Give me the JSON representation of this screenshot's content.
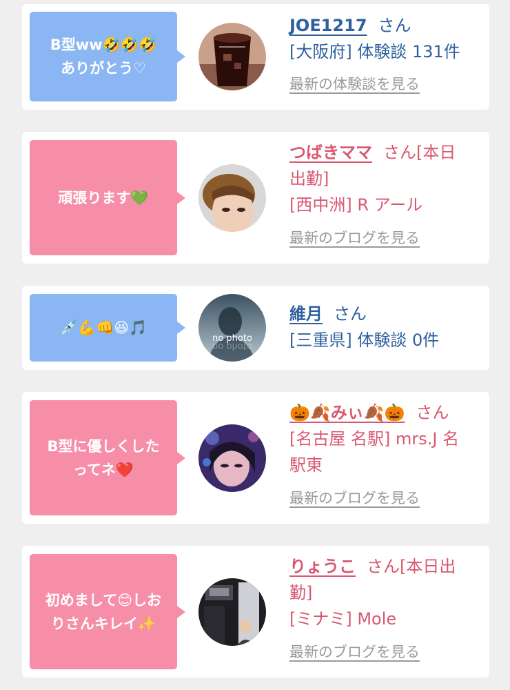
{
  "entries": [
    {
      "bubble": [
        "B型ww🤣🤣🤣",
        "ありがとう♡"
      ],
      "name": "JOE1217",
      "suffix": "さん",
      "lines": [
        "[大阪府] 体験談 131件"
      ],
      "link": "最新の体験談を見る"
    },
    {
      "bubble": [
        "頑張ります💚"
      ],
      "name": "つばきママ",
      "suffix": "さん[本日",
      "lines": [
        "出勤]",
        "[西中洲] R アール"
      ],
      "link": "最新のブログを見る"
    },
    {
      "bubble": [
        "💉💪👊😆🎵"
      ],
      "name": "維月",
      "suffix": "さん",
      "lines": [
        "[三重県] 体験談 0件"
      ],
      "avatar_text": "no photo"
    },
    {
      "bubble": [
        "B型に優しくした",
        "ってネ❤️"
      ],
      "name": "🎃🍂みぃ🍂🎃",
      "suffix": "さん",
      "lines": [
        "[名古屋 名駅] mrs.J 名",
        "駅東"
      ],
      "link": "最新のブログを見る"
    },
    {
      "bubble": [
        "初めまして😊しお",
        "りさんキレイ✨"
      ],
      "name": "りょうこ",
      "suffix": "さん[本日出",
      "lines": [
        "勤]",
        "[ミナミ] Mole"
      ],
      "link": "最新のブログを見る"
    }
  ]
}
